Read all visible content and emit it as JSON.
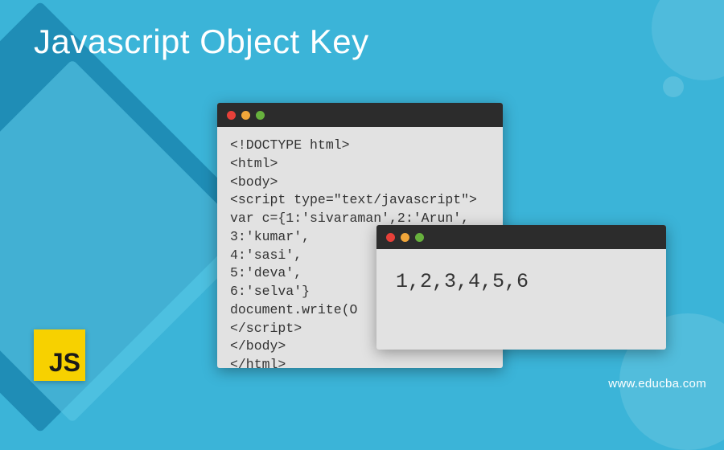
{
  "title": "Javascript Object Key",
  "code_window": {
    "lines": "<!DOCTYPE html>\n<html>\n<body>\n<script type=\"text/javascript\">\nvar c={1:'sivaraman',2:'Arun',\n3:'kumar',\n4:'sasi',\n5:'deva',\n6:'selva'}\ndocument.write(O\n</script>\n</body>\n</html>"
  },
  "output_window": {
    "text": "1,2,3,4,5,6"
  },
  "js_logo": {
    "label": "JS"
  },
  "watermark": "www.educba.com"
}
